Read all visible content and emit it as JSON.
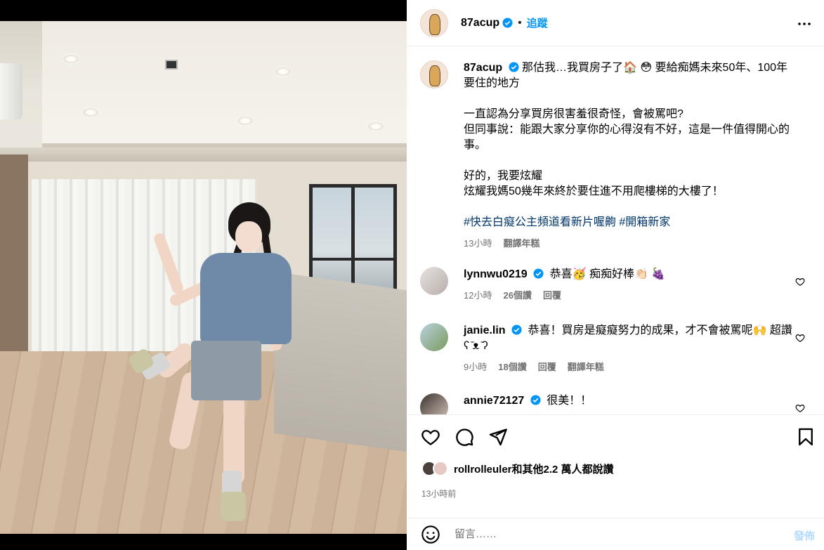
{
  "post": {
    "username": "87acup",
    "follow_label": "追蹤",
    "separator": "•"
  },
  "caption": {
    "username": "87acup",
    "line1": "那估我…我買房子了🏠 😳 要給痴媽未來50年、100年要住的地方",
    "para2": "一直認為分享買房很害羞很奇怪，會被罵吧?\n但同事說：能跟大家分享你的心得沒有不好，這是一件值得開心的事。",
    "para3": "好的，我要炫耀\n炫耀我媽50幾年來終於要住進不用爬樓梯的大樓了！",
    "hashtags": "#快去白癡公主頻道看新片喔齁 #開箱新家",
    "time": "13小時",
    "translate": "翻譯年糕"
  },
  "comments": [
    {
      "username": "lynnwu0219",
      "text": "恭喜🥳 痴痴好棒👏🏻 🍇",
      "time": "12小時",
      "likes": "26個讚",
      "reply": "回覆"
    },
    {
      "username": "janie.lin",
      "text": "恭喜！買房是癡癡努力的成果，才不會被罵呢🙌 超讚ʕ ̄ᴥ ̄ʔ",
      "time": "9小時",
      "likes": "18個讚",
      "reply": "回覆",
      "translate": "翻譯年糕"
    },
    {
      "username": "annie72127",
      "text": "很美！！"
    }
  ],
  "likes_summary": {
    "text": "rollrolleuler和其他2.2 萬人都說讚"
  },
  "timestamp": "13小時前",
  "comment_box": {
    "placeholder": "留言……",
    "post_label": "發佈"
  },
  "icons": {
    "verified": "verified-badge-icon",
    "more": "more-options-icon",
    "like": "heart-icon",
    "comment": "comment-icon",
    "share": "share-icon",
    "save": "bookmark-icon",
    "emoji": "emoji-icon"
  },
  "colors": {
    "accent": "#0095f6",
    "hashtag": "#00376b",
    "muted": "#737373",
    "verified": "#0095f6"
  }
}
